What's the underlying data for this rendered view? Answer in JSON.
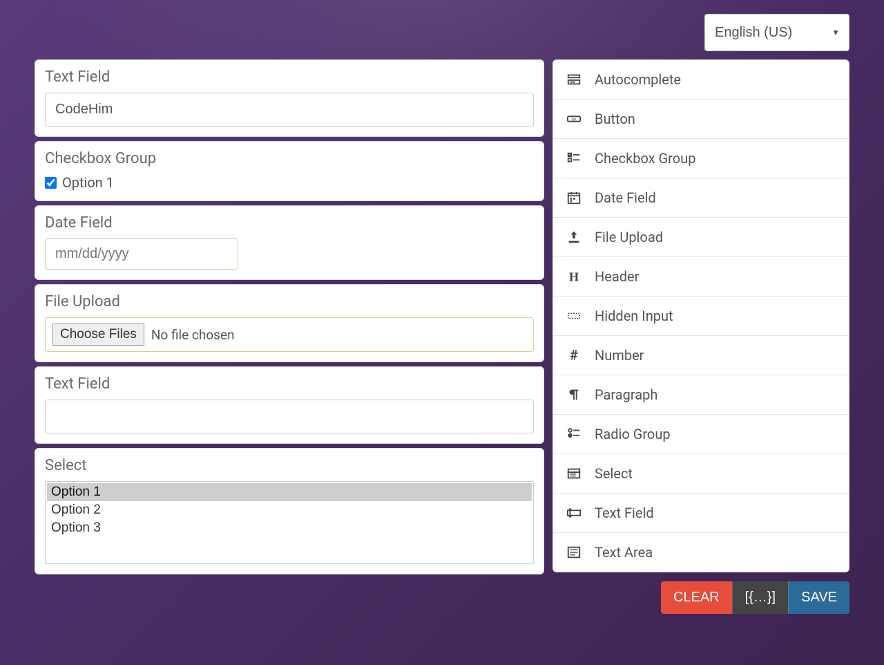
{
  "language": {
    "selected": "English (US)"
  },
  "canvas": {
    "text1": {
      "label": "Text Field",
      "value": "CodeHim"
    },
    "check": {
      "label": "Checkbox Group",
      "option": "Option 1",
      "checked": true
    },
    "date": {
      "label": "Date Field",
      "placeholder": "mm/dd/yyyy"
    },
    "file": {
      "label": "File Upload",
      "button": "Choose Files",
      "status": "No file chosen"
    },
    "text2": {
      "label": "Text Field",
      "value": ""
    },
    "select": {
      "label": "Select",
      "options": [
        "Option 1",
        "Option 2",
        "Option 3"
      ],
      "selected": "Option 1"
    }
  },
  "palette": [
    {
      "icon": "autocomplete",
      "label": "Autocomplete"
    },
    {
      "icon": "button",
      "label": "Button"
    },
    {
      "icon": "checkbox",
      "label": "Checkbox Group"
    },
    {
      "icon": "date",
      "label": "Date Field"
    },
    {
      "icon": "upload",
      "label": "File Upload"
    },
    {
      "icon": "header",
      "label": "Header"
    },
    {
      "icon": "hidden",
      "label": "Hidden Input"
    },
    {
      "icon": "number",
      "label": "Number"
    },
    {
      "icon": "paragraph",
      "label": "Paragraph"
    },
    {
      "icon": "radio",
      "label": "Radio Group"
    },
    {
      "icon": "select",
      "label": "Select"
    },
    {
      "icon": "textfield",
      "label": "Text Field"
    },
    {
      "icon": "textarea",
      "label": "Text Area"
    }
  ],
  "actions": {
    "clear": "CLEAR",
    "json": "[{…}]",
    "save": "SAVE"
  }
}
